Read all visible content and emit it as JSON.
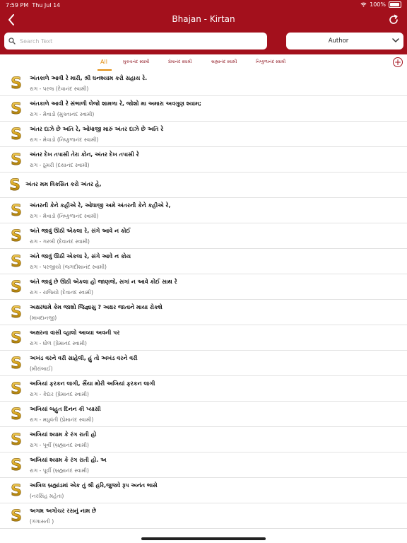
{
  "status": {
    "time": "7:59 PM",
    "date": "Thu Jul 14",
    "battery": "100%"
  },
  "header": {
    "title": "Bhajan - Kirtan",
    "background": "#a3101c"
  },
  "search": {
    "placeholder": "Search Text",
    "value": ""
  },
  "author_filter": {
    "selected": "Author"
  },
  "tabs": [
    {
      "label": "All",
      "active": true
    },
    {
      "label": "મુક્તાનંદ સ્વામી",
      "active": false
    },
    {
      "label": "પ્રેમાનંદ સ્વામી",
      "active": false
    },
    {
      "label": "બ્રહ્માનંદ સ્વામી",
      "active": false
    },
    {
      "label": "નિષ્કુળાનંદ સ્વામી",
      "active": false
    }
  ],
  "colors": {
    "accent": "#a3101c",
    "active_tab": "#e28e10",
    "icon_gold": "#d4a017"
  },
  "items": [
    {
      "title": "અંતકાળે આવી રે મારી, શ્રી ઘનશ્યામ કરો સહાય રે.",
      "subtitle": "રાગ - પરજ (દેવાનંદ સ્વામી)"
    },
    {
      "title": "અંતકાળે આવી રે સંભાળી લેજો શામળા રે, જોશો મા અમારા અવગુણ શ્યામ;",
      "subtitle": "રાગ - મેવાડો (મુક્તાનંદ સ્વામી)"
    },
    {
      "title": "અંતર દાઝે છે અતિ રે, ઓધાજી મારું અંતર દાઝે છે અતિ રે",
      "subtitle": "રાગ - મેવાડો (નિષ્કુળાનંદ સ્વામી)"
    },
    {
      "title": "અંતર દેખ તપાસી તેરા કોન, અંતર દેખ તપાસી રે",
      "subtitle": "રાગ - ઠૂમરી (દયાનંદ સ્વામી)"
    },
    {
      "title": "અંતર મમ વિકસિત કરો અંતર હે,",
      "subtitle": ""
    },
    {
      "title": "અંતરની કેને કહીએ રે, ઓધાજી અમે અંતરની કેને કહીએ રે,",
      "subtitle": "રાગ - મેવાડો (નિષ્કુળાનંદ સ્વામી)"
    },
    {
      "title": "અંતે જાવું ઊઠી એકલા રે, સંગે આવે ન કોઈ",
      "subtitle": "રાગ - ગરબી (દેવાનંદ સ્વામી)"
    },
    {
      "title": "અંતે જાવું ઊઠી એકલા રે, સંગે આવે ન કોય",
      "subtitle": "રાગ - પરજીયો (જગદીશાનંદ સ્વામી)"
    },
    {
      "title": "અંતે જાવું છે ઊઠી એકલા હો જાણજે, સગાં ન આવે કોઈ સાથ રે",
      "subtitle": "રાગ - રાજિયો (દેવાનંદ સ્વામી)"
    },
    {
      "title": "અક્ષરધામે કેમ જાશો જિજ્ઞાસુ ? અક્ષર જાતાને માયા રોકશે",
      "subtitle": "(માવદાનજી)"
    },
    {
      "title": "અક્ષરના વાસી વ્હાલો આવ્યા અવની પર",
      "subtitle": "રાગ - ધોળ (પ્રેમાનંદ સ્વામી)"
    },
    {
      "title": "અખંડ વરને વરી સાહેલી, હું તો અખંડ વરને વરી",
      "subtitle": "(મીરાંબાઈ)"
    },
    {
      "title": "અખિયાં ફરકન લાગી, સૈંયા મોરી અખિયાં ફરકન લાગી",
      "subtitle": "રાગ - કેદાર (પ્રેમાનંદ સ્વામી)"
    },
    {
      "title": "અખિયાં બહુત દિનન કી પ્યાસી",
      "subtitle": "રાગ - મધુવંતી (પ્રેમાનંદ સ્વામી)"
    },
    {
      "title": "અખિયાં શ્યામ કે રંગ રાતી હો",
      "subtitle": "રાગ - પૂર્વી (બ્રહ્માનંદ સ્વામી)"
    },
    {
      "title": "અખિયાં શ્યામ કે રંગ રાતી હો. અ",
      "subtitle": "રાગ - પૂર્વી (બ્રહ્માનંદ સ્વામી)"
    },
    {
      "title": "અખિલ બ્રહ્માંડમાં એક તું શ્રી હરિ,જુજવે રૂપ અનંત ભાસે",
      "subtitle": "(નરસિંહ મહેતા)"
    },
    {
      "title": "અગમ અગોચર રસનું નામ છે",
      "subtitle": "(ગંગાસતી )"
    }
  ]
}
